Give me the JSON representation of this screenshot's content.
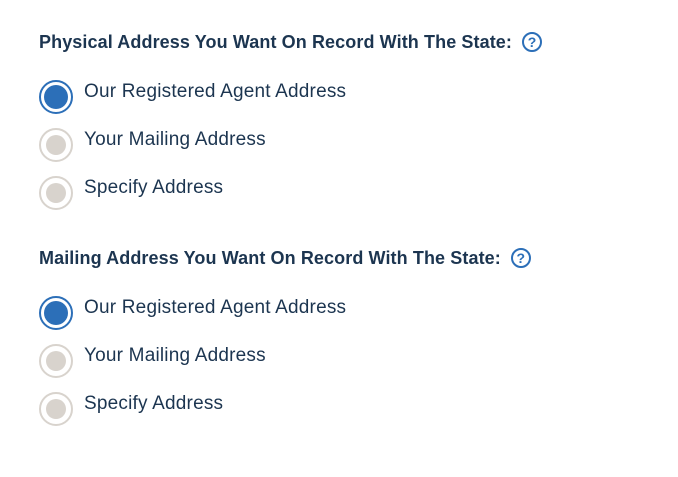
{
  "physical_section": {
    "heading": "Physical Address You Want On Record With The State:",
    "help_glyph": "?",
    "options": [
      {
        "label": "Our Registered Agent Address",
        "checked": true
      },
      {
        "label": "Your Mailing Address",
        "checked": false
      },
      {
        "label": "Specify Address",
        "checked": false
      }
    ]
  },
  "mailing_section": {
    "heading": "Mailing Address You Want On Record With The State:",
    "help_glyph": "?",
    "options": [
      {
        "label": "Our Registered Agent Address",
        "checked": true
      },
      {
        "label": "Your Mailing Address",
        "checked": false
      },
      {
        "label": "Specify Address",
        "checked": false
      }
    ]
  },
  "colors": {
    "accent": "#2c6fb8",
    "text": "#1c3550",
    "radio_unchecked": "#d8d3cd"
  }
}
